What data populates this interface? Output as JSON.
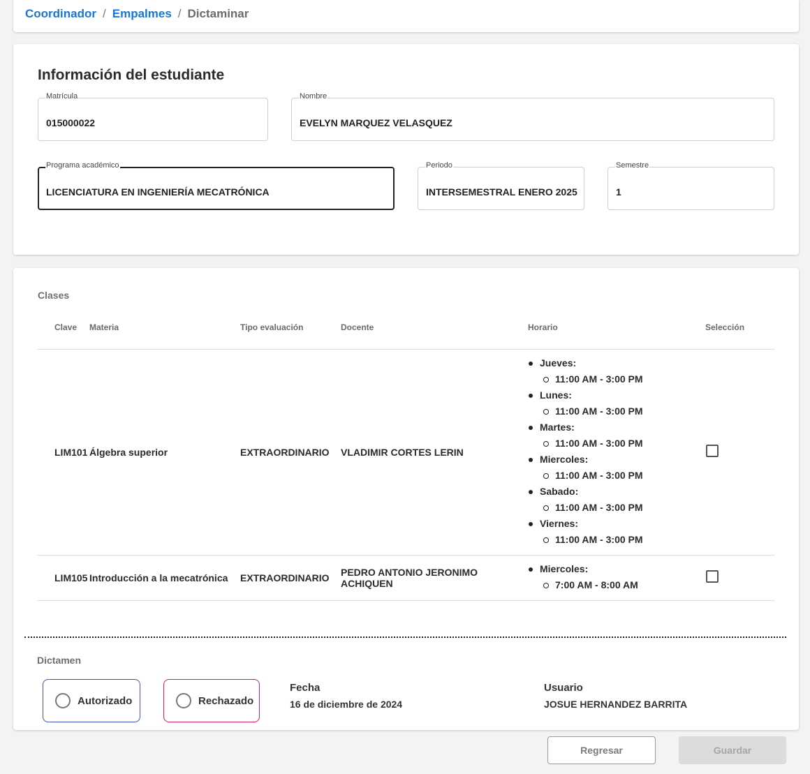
{
  "breadcrumb": {
    "items": [
      "Coordinador",
      "Empalmes",
      "Dictaminar"
    ],
    "separator": "/"
  },
  "student": {
    "section_title": "Información del estudiante",
    "matricula": {
      "label": "Matrícula",
      "value": "015000022"
    },
    "nombre": {
      "label": "Nombre",
      "value": "EVELYN MARQUEZ VELASQUEZ"
    },
    "programa": {
      "label": "Programa académico",
      "value": "LICENCIATURA EN INGENIERÍA MECATRÓNICA"
    },
    "periodo": {
      "label": "Periodo",
      "value": "INTERSEMESTRAL ENERO 2025"
    },
    "semestre": {
      "label": "Semestre",
      "value": "1"
    }
  },
  "classes": {
    "title": "Clases",
    "columns": [
      "Clave",
      "Materia",
      "Tipo evaluación",
      "Docente",
      "Horario",
      "Selección"
    ],
    "rows": [
      {
        "clave": "LIM101",
        "materia": "Álgebra superior",
        "tipo": "EXTRAORDINARIO",
        "docente": "VLADIMIR CORTES LERIN",
        "horario": [
          {
            "day": "Jueves:",
            "time": "11:00 AM - 3:00 PM"
          },
          {
            "day": "Lunes:",
            "time": "11:00 AM - 3:00 PM"
          },
          {
            "day": "Martes:",
            "time": "11:00 AM - 3:00 PM"
          },
          {
            "day": "Miercoles:",
            "time": "11:00 AM - 3:00 PM"
          },
          {
            "day": "Sabado:",
            "time": "11:00 AM - 3:00 PM"
          },
          {
            "day": "Viernes:",
            "time": "11:00 AM - 3:00 PM"
          }
        ],
        "selected": false
      },
      {
        "clave": "LIM105",
        "materia": "Introducción a la mecatrónica",
        "tipo": "EXTRAORDINARIO",
        "docente": "PEDRO ANTONIO JERONIMO ACHIQUEN",
        "horario": [
          {
            "day": "Miercoles:",
            "time": "7:00 AM - 8:00 AM"
          }
        ],
        "selected": false
      }
    ]
  },
  "dictamen": {
    "title": "Dictamen",
    "options": [
      {
        "label": "Autorizado",
        "color": "#3f51b5"
      },
      {
        "label": "Rechazado",
        "color": "#d81b60"
      }
    ],
    "fecha_label": "Fecha",
    "fecha_value": "16 de diciembre de 2024",
    "usuario_label": "Usuario",
    "usuario_value": "JOSUE HERNANDEZ BARRITA"
  },
  "buttons": {
    "back": "Regresar",
    "save": "Guardar"
  },
  "colors": {
    "link": "#1976d2",
    "background": "#f3f3f3"
  }
}
